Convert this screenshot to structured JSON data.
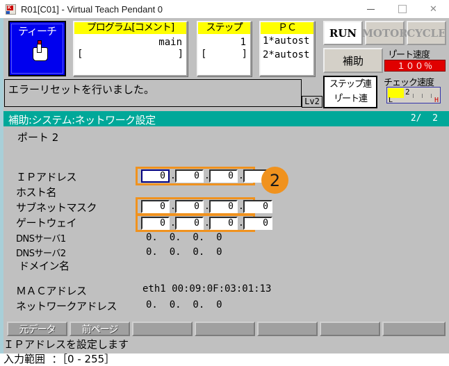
{
  "window": {
    "title": "R01[C01] - Virtual Teach Pendant 0",
    "icon": "app-icon",
    "minimize_label": "—",
    "maximize_label": "□",
    "close_label": "✕"
  },
  "topbar": {
    "teach": {
      "label": "ティーチ",
      "icon": "hand-pointer-icon",
      "active": true,
      "bg": "#0000ee"
    },
    "program": {
      "header": "プログラム[コメント]",
      "value": "main",
      "bracket_left": "[",
      "bracket_right": "]"
    },
    "step": {
      "header": "ステップ゚",
      "value": "1",
      "bracket_left": "[",
      "bracket_right": "]"
    },
    "pc": {
      "header": "ＰＣ",
      "line1": "1*autost",
      "line2": "2*autost"
    },
    "lamps": [
      {
        "label": "RUN",
        "state": "on"
      },
      {
        "label": "MOTOR",
        "state": "off"
      },
      {
        "label": "CYCLE",
        "state": "off"
      }
    ],
    "aux_button": "補助",
    "repeat_speed": {
      "caption": "リ゚ート速度",
      "value": "１００％",
      "bar_color": "#e00000"
    },
    "check_speed": {
      "caption": "チェック速度",
      "value": "2",
      "low": "L",
      "high": "H",
      "fill_color": "#ffff00"
    },
    "mode_box": {
      "line1": "ステップ゚連",
      "line2": "リ゚ート連"
    }
  },
  "message": {
    "text": "エラーリセットを行いました。",
    "level": "Lv2"
  },
  "screen_header": {
    "title": "補助:システム:ネットワーク設定",
    "page": "2/  2",
    "bg": "#00a899"
  },
  "form": {
    "port_label": "ポート 2",
    "badge": "2",
    "highlight_color": "#f0921e",
    "rows": [
      {
        "label": "ＩＰアドレス",
        "type": "octets",
        "editable": true,
        "highlighted": true,
        "octets": [
          "0",
          "0",
          "0",
          "0"
        ],
        "selected_index": 0
      },
      {
        "label": "ホスト名",
        "type": "text",
        "editable": true,
        "value": ""
      },
      {
        "label": "サブネットマスク",
        "type": "octets",
        "editable": true,
        "highlighted": true,
        "octets": [
          "0",
          "0",
          "0",
          "0"
        ]
      },
      {
        "label": "ゲートウェイ",
        "type": "octets",
        "editable": true,
        "highlighted": true,
        "octets": [
          "0",
          "0",
          "0",
          "0"
        ]
      },
      {
        "label": "DNSサーバ1",
        "type": "readonly",
        "value": "0.  0.  0.  0"
      },
      {
        "label": "DNSサーバ2",
        "type": "readonly",
        "value": "0.  0.  0.  0"
      },
      {
        "label": "ドメイン名",
        "type": "readonly",
        "value": ""
      },
      {
        "label": "ＭＡＣアドレス",
        "type": "readonly",
        "value": "eth1 00:09:0F:03:01:13"
      },
      {
        "label": "ネットワークアドレス",
        "type": "readonly",
        "value": "0.  0.  0.  0"
      }
    ]
  },
  "function_buttons": [
    {
      "label": "元データ"
    },
    {
      "label": "前ページ"
    },
    {
      "label": ""
    },
    {
      "label": ""
    },
    {
      "label": ""
    },
    {
      "label": ""
    },
    {
      "label": ""
    }
  ],
  "status": {
    "line1": "ＩＰアドレスを設定します",
    "line2": "入力範囲  ：［0 - 255］"
  }
}
